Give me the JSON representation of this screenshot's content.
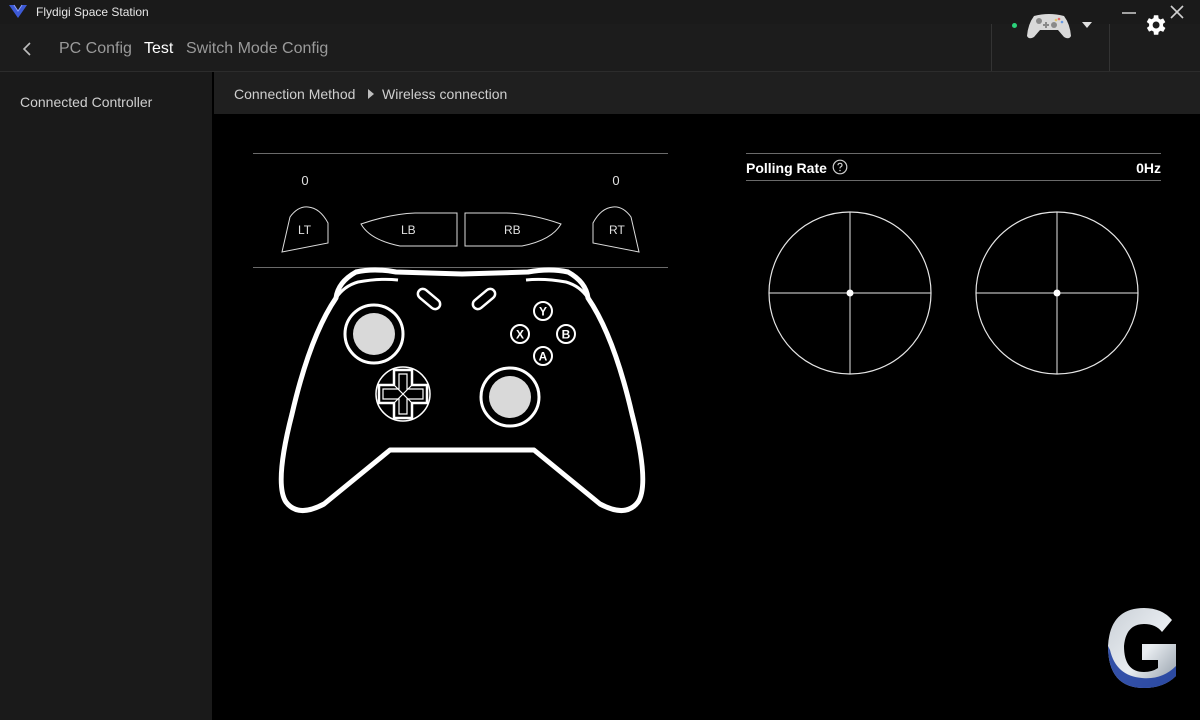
{
  "window": {
    "title": "Flydigi Space Station",
    "logo_icon": "flydigi-logo-icon",
    "accent_color": "#3d5ad6"
  },
  "nav": {
    "tabs": [
      {
        "label": "PC Config",
        "active": false
      },
      {
        "label": "Test",
        "active": true
      },
      {
        "label": "Switch Mode Config",
        "active": false
      }
    ],
    "status_color": "#2ad27a"
  },
  "sidebar": {
    "items": [
      {
        "label": "Connected Controller"
      }
    ]
  },
  "breadcrumb": {
    "items": [
      "Connection Method",
      "Wireless connection"
    ]
  },
  "test": {
    "triggers": {
      "lt_value": "0",
      "rt_value": "0"
    },
    "shoulders": {
      "lt": "LT",
      "lb": "LB",
      "rb": "RB",
      "rt": "RT"
    },
    "face_buttons": {
      "y": "Y",
      "x": "X",
      "b": "B",
      "a": "A"
    },
    "polling": {
      "label": "Polling Rate",
      "value": "0Hz"
    }
  }
}
